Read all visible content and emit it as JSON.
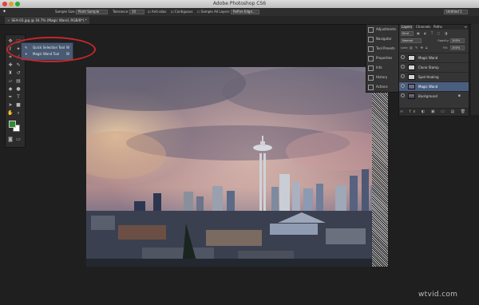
{
  "window": {
    "title": "Adobe Photoshop CS6"
  },
  "options_bar": {
    "tool_glyph": "✦",
    "sample_size_label": "Sample Size:",
    "sample_size_value": "Point Sample",
    "tolerance_label": "Tolerance:",
    "tolerance_value": "10",
    "anti_alias_label": "Anti-alias",
    "contiguous_label": "Contiguous",
    "sample_all_layers_label": "Sample All Layers",
    "refine_edge_label": "Refine Edge...",
    "workspace_value": "Untitled 1"
  },
  "document_tab": {
    "label": "SEA-03.jpg @ 16.7% (Magic Wand, RGB/8*) *"
  },
  "tool_flyout": {
    "items": [
      {
        "label": "Quick Selection Tool",
        "shortcut": "W"
      },
      {
        "label": "Magic Wand Tool",
        "shortcut": "W"
      }
    ]
  },
  "icon_panel": {
    "items": [
      {
        "label": "Adjustments",
        "icon": "adjustments-icon"
      },
      {
        "label": "Navigator",
        "icon": "navigator-icon"
      },
      {
        "label": "Tool Presets",
        "icon": "tool-presets-icon"
      },
      {
        "label": "Properties",
        "icon": "properties-icon"
      },
      {
        "label": "Info",
        "icon": "info-icon"
      },
      {
        "label": "History",
        "icon": "history-icon"
      },
      {
        "label": "Actions",
        "icon": "actions-icon"
      }
    ]
  },
  "layers_panel": {
    "tabs": [
      "Layers",
      "Channels",
      "Paths"
    ],
    "kind_value": "Kind",
    "blend_mode": "Normal",
    "opacity_label": "Opacity:",
    "opacity_value": "100%",
    "lock_label": "Lock:",
    "fill_label": "Fill:",
    "fill_value": "100%",
    "layers": [
      {
        "name": "Magic Wand",
        "selected": false
      },
      {
        "name": "Clone Stamp",
        "selected": false
      },
      {
        "name": "Spot Healing",
        "selected": false
      },
      {
        "name": "Magic Wand",
        "selected": true
      },
      {
        "name": "Background",
        "selected": false
      }
    ]
  },
  "colors": {
    "foreground": "#2e8b2e",
    "background": "#ffffff",
    "highlight_circle": "#c4272d",
    "flyout_bg": "#495a73",
    "selected_layer": "#4a5e80"
  },
  "watermark": "wtvid.com"
}
